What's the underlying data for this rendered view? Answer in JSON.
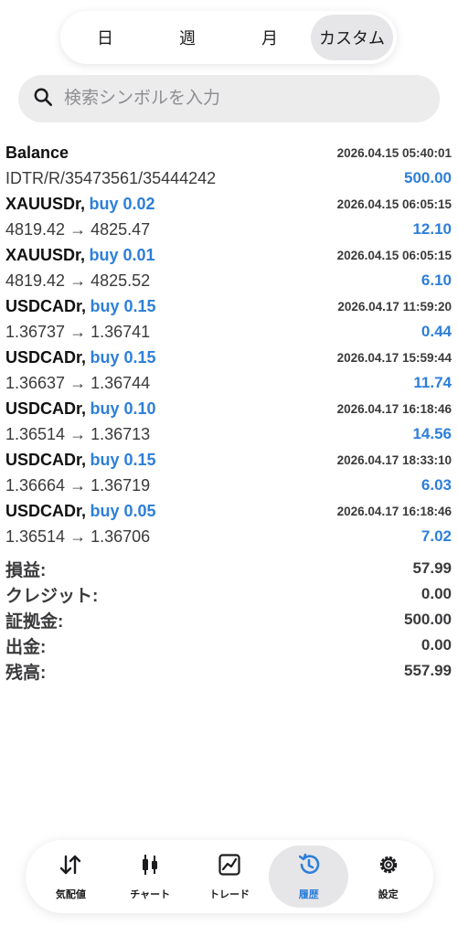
{
  "period_tabs": [
    {
      "label": "日",
      "active": false
    },
    {
      "label": "週",
      "active": false
    },
    {
      "label": "月",
      "active": false
    },
    {
      "label": "カスタム",
      "active": true
    }
  ],
  "search": {
    "placeholder": "検索シンボルを入力",
    "icon": "search-icon"
  },
  "balance_entry": {
    "title": "Balance",
    "time": "2026.04.15 05:40:01",
    "comment": "IDTR/R/35473561/35444242",
    "amount": "500.00"
  },
  "deals": [
    {
      "symbol": "XAUUSDr,",
      "side": "buy 0.02",
      "time": "2026.04.15 06:05:15",
      "prices": "4819.42 → 4825.47",
      "profit": "12.10"
    },
    {
      "symbol": "XAUUSDr,",
      "side": "buy 0.01",
      "time": "2026.04.15 06:05:15",
      "prices": "4819.42 → 4825.52",
      "profit": "6.10"
    },
    {
      "symbol": "USDCADr,",
      "side": "buy 0.15",
      "time": "2026.04.17 11:59:20",
      "prices": "1.36737 → 1.36741",
      "profit": "0.44"
    },
    {
      "symbol": "USDCADr,",
      "side": "buy 0.15",
      "time": "2026.04.17 15:59:44",
      "prices": "1.36637 → 1.36744",
      "profit": "11.74"
    },
    {
      "symbol": "USDCADr,",
      "side": "buy 0.10",
      "time": "2026.04.17 16:18:46",
      "prices": "1.36514 → 1.36713",
      "profit": "14.56"
    },
    {
      "symbol": "USDCADr,",
      "side": "buy 0.15",
      "time": "2026.04.17 18:33:10",
      "prices": "1.36664 → 1.36719",
      "profit": "6.03"
    },
    {
      "symbol": "USDCADr,",
      "side": "buy 0.05",
      "time": "2026.04.17 16:18:46",
      "prices": "1.36514 → 1.36706",
      "profit": "7.02"
    }
  ],
  "summary": [
    {
      "label": "損益:",
      "value": "57.99"
    },
    {
      "label": "クレジット:",
      "value": "0.00"
    },
    {
      "label": "証拠金:",
      "value": "500.00"
    },
    {
      "label": "出金:",
      "value": "0.00"
    },
    {
      "label": "残高:",
      "value": "557.99"
    }
  ],
  "bottom_nav": [
    {
      "label": "気配値",
      "icon": "quotes-icon",
      "active": false
    },
    {
      "label": "チャート",
      "icon": "chart-candles-icon",
      "active": false
    },
    {
      "label": "トレード",
      "icon": "trade-icon",
      "active": false
    },
    {
      "label": "履歴",
      "icon": "history-icon",
      "active": true
    },
    {
      "label": "設定",
      "icon": "settings-icon",
      "active": false
    }
  ],
  "colors": {
    "accent": "#2d7fd9",
    "active_pill": "#e6e6e8",
    "search_bg": "#ececed"
  }
}
